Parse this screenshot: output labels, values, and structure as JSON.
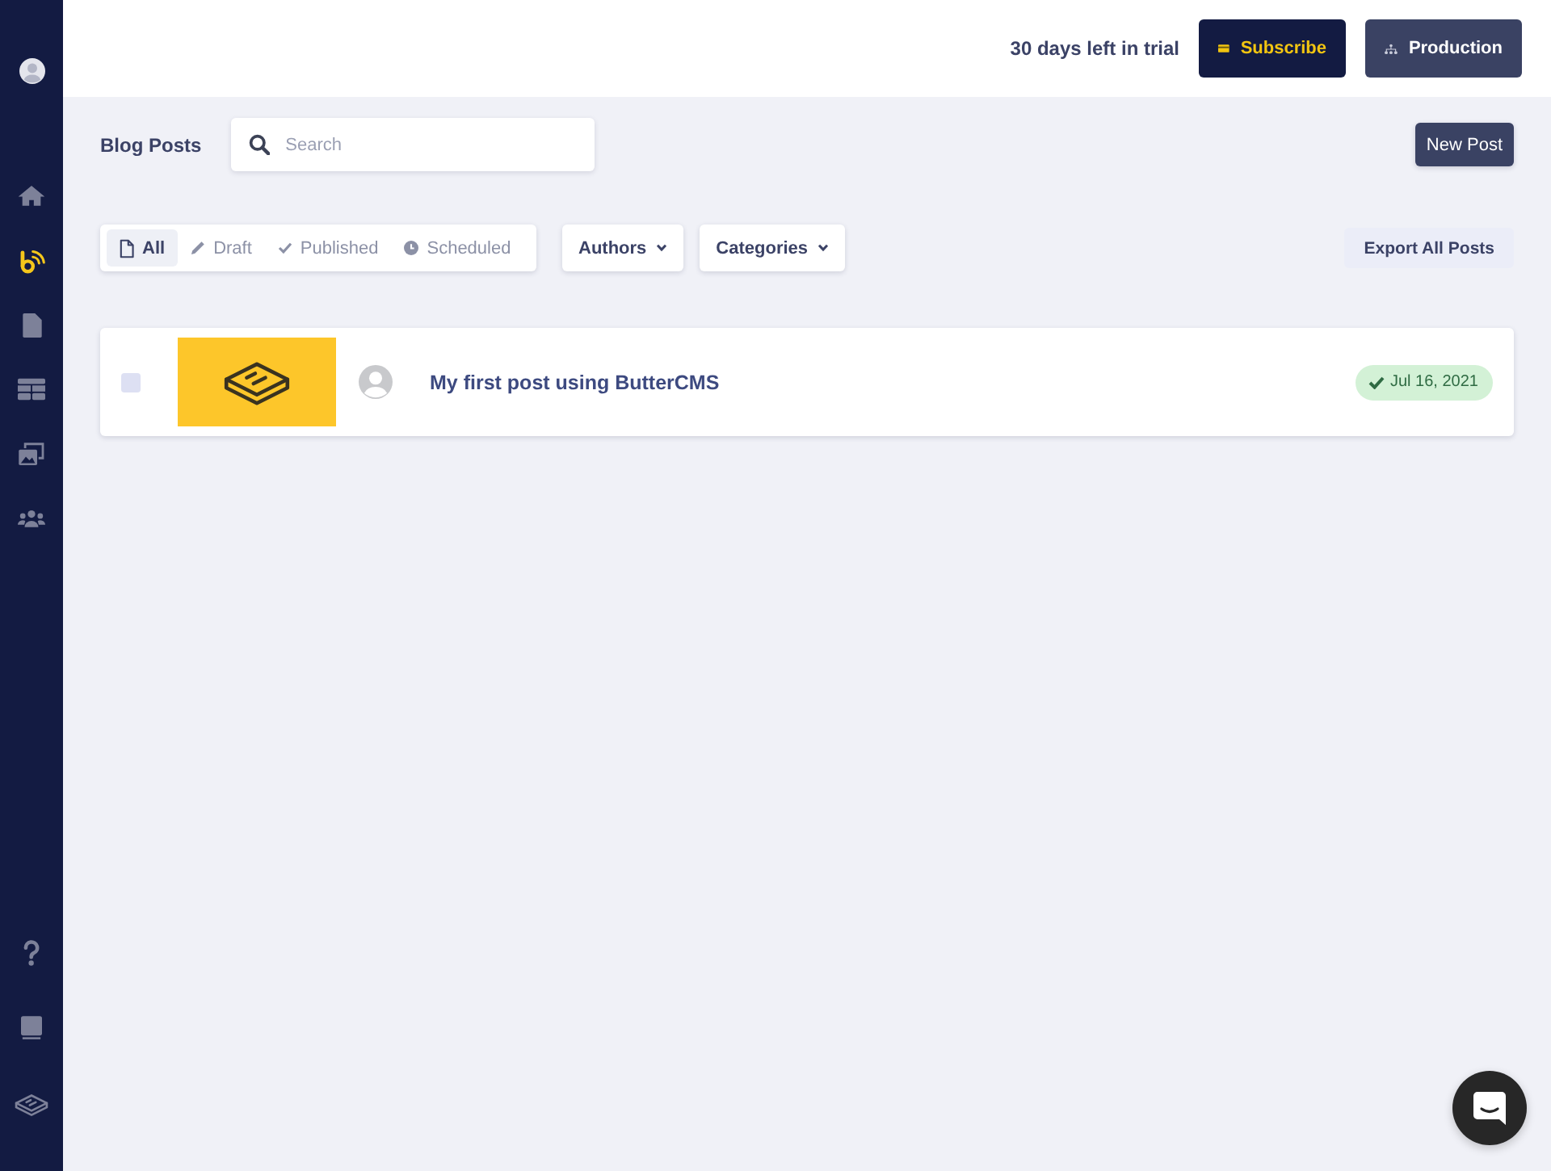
{
  "sidebar": {
    "nav_items": [
      {
        "kind": "home",
        "selected": false
      },
      {
        "kind": "blog",
        "selected": true
      },
      {
        "kind": "pages",
        "selected": false
      },
      {
        "kind": "collections",
        "selected": false
      },
      {
        "kind": "media",
        "selected": false
      },
      {
        "kind": "users",
        "selected": false
      }
    ],
    "bottom_items": [
      {
        "kind": "help"
      },
      {
        "kind": "docs"
      },
      {
        "kind": "logo"
      }
    ]
  },
  "header": {
    "trial_notice": "30 days left in trial",
    "subscribe_button": "Subscribe",
    "environment_button": "Production"
  },
  "toolbar": {
    "title": "Blog Posts",
    "search": {
      "placeholder": "Search"
    },
    "new_post_button": "New Post"
  },
  "filters": {
    "status_tabs": [
      {
        "kind": "all",
        "label": "All",
        "selected": true
      },
      {
        "kind": "draft",
        "label": "Draft",
        "selected": false
      },
      {
        "kind": "published",
        "label": "Published",
        "selected": false
      },
      {
        "kind": "scheduled",
        "label": "Scheduled",
        "selected": false
      }
    ],
    "dropdowns": [
      "Authors",
      "Categories"
    ],
    "export_link": "Export All Posts"
  },
  "posts": [
    {
      "checked": false,
      "title": "My first post using ButterCMS",
      "published": true,
      "date": "Jul 16, 2021"
    }
  ]
}
